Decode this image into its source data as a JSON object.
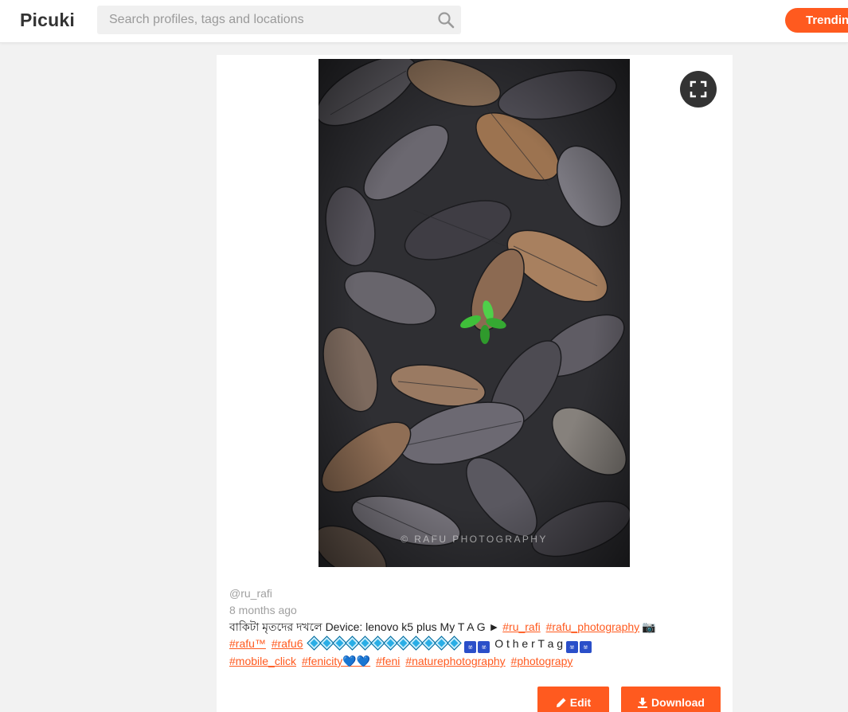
{
  "header": {
    "logo": "Picuki",
    "search_placeholder": "Search profiles, tags and locations",
    "trending_label": "Trendin"
  },
  "post": {
    "watermark": "© RAFU PHOTOGRAPHY",
    "username": "@ru_rafi",
    "time_ago": "8 months ago",
    "caption_text": "বাকিটা মৃতদের দখলে Device: lenovo k5 plus My T A G ►",
    "tags_line1": [
      "#ru_rafi",
      "#rafu_photography"
    ],
    "tags_line2": [
      "#rafu™",
      "#rafu6"
    ],
    "other_tag_text": "O t h e r T a g",
    "tags_line3": [
      "#mobile_click",
      "#fenicity💙💙",
      "#feni",
      "#naturephotography",
      "#photograpy"
    ]
  },
  "actions": {
    "edit_label": "Edit",
    "download_label": "Download"
  },
  "colors": {
    "accent": "#ff5a1f",
    "background": "#f2f2f2",
    "fullscreen_button": "#333333"
  },
  "icons": [
    "search-icon",
    "fullscreen-icon",
    "camera-icon",
    "pencil-icon",
    "download-icon"
  ]
}
